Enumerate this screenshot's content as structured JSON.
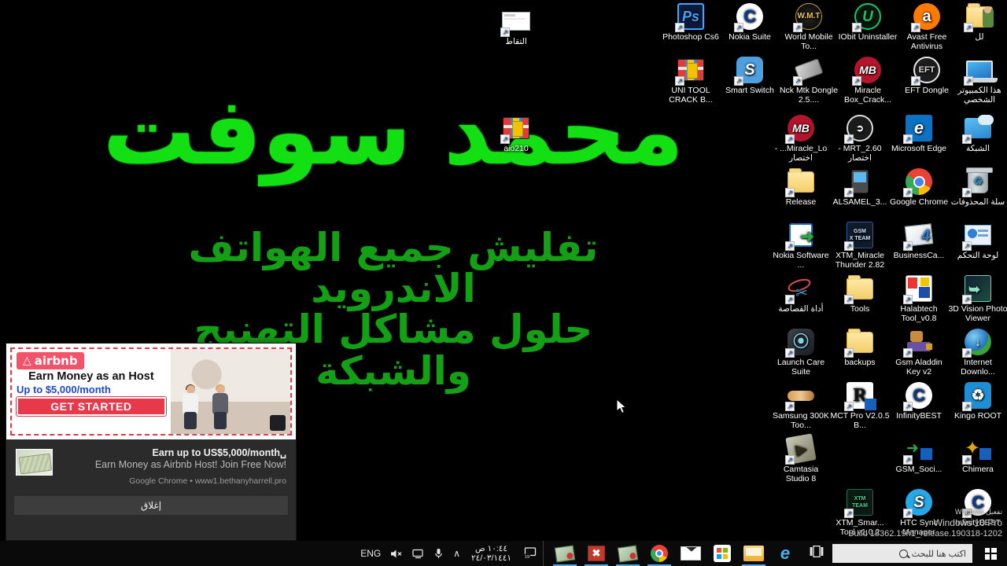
{
  "wallpaper": {
    "title": "محمد سوفت",
    "line1": "تفليش جميع الهواتف",
    "line2": "الاندرويد",
    "line3": "حلول مشاكل التهنيج",
    "line4": "والشبكة",
    "accent_color": "#12e012",
    "sub_color": "#14a014",
    "background_color": "#000000"
  },
  "desktop_icons": [
    {
      "label": "التقاط",
      "icon": "screenshot-capture-icon",
      "rtl": true
    },
    {
      "label": "aio210",
      "icon": "winrar-archive-icon",
      "rtl": false
    },
    {
      "label": "Photoshop Cs6",
      "icon": "photoshop-icon",
      "rtl": false
    },
    {
      "label": "Nokia Suite",
      "icon": "nokia-suite-icon",
      "rtl": false
    },
    {
      "label": "World Mobile To...",
      "icon": "world-mobile-tool-icon",
      "rtl": false
    },
    {
      "label": "IObit Uninstaller",
      "icon": "iobit-uninstaller-icon",
      "rtl": false
    },
    {
      "label": "Avast Free Antivirus",
      "icon": "avast-antivirus-icon",
      "rtl": false
    },
    {
      "label": "لل",
      "icon": "shared-folder-icon",
      "rtl": true
    },
    {
      "label": "UNI TOOL CRACK B...",
      "icon": "winrar-archive-icon",
      "rtl": false
    },
    {
      "label": "Smart Switch",
      "icon": "smart-switch-icon",
      "rtl": false
    },
    {
      "label": "Nck Mtk Dongle 2.5....",
      "icon": "nck-dongle-icon",
      "rtl": false
    },
    {
      "label": "Miracle Box_Crack...",
      "icon": "miracle-box-icon",
      "rtl": false
    },
    {
      "label": "EFT Dongle",
      "icon": "eft-dongle-icon",
      "rtl": false
    },
    {
      "label": "هذا الكمبيوتر الشخصي",
      "icon": "this-pc-icon",
      "rtl": true
    },
    {
      "label": "Miracle_Lo... - اختصار",
      "icon": "miracle-loader-icon",
      "rtl": true
    },
    {
      "label": "MRT_2.60 - اختصار",
      "icon": "mrt-dongle-icon",
      "rtl": true
    },
    {
      "label": "Microsoft Edge",
      "icon": "microsoft-edge-icon",
      "rtl": false
    },
    {
      "label": "الشبكة",
      "icon": "network-icon",
      "rtl": true
    },
    {
      "label": "Release",
      "icon": "folder-icon",
      "rtl": false
    },
    {
      "label": "ALSAMEL_3...",
      "icon": "alsamel-phone-icon",
      "rtl": false
    },
    {
      "label": "Google Chrome",
      "icon": "google-chrome-icon",
      "rtl": false
    },
    {
      "label": "سلة المحذوفات",
      "icon": "recycle-bin-icon",
      "rtl": true
    },
    {
      "label": "Nokia Software ...",
      "icon": "nokia-software-updater-icon",
      "rtl": false
    },
    {
      "label": "XTM_Miracle Thunder 2.82",
      "icon": "gsm-x-team-icon",
      "rtl": false
    },
    {
      "label": "BusinessCa...",
      "icon": "business-cards-icon",
      "rtl": false
    },
    {
      "label": "لوحة التحكم",
      "icon": "control-panel-icon",
      "rtl": true
    },
    {
      "label": "أداة القصاصة",
      "icon": "snipping-tool-icon",
      "rtl": true
    },
    {
      "label": "Tools",
      "icon": "folder-icon",
      "rtl": false
    },
    {
      "label": "Halabtech Tool_v0.8",
      "icon": "halabtech-tool-icon",
      "rtl": false
    },
    {
      "label": "3D Vision Photo Viewer",
      "icon": "3d-vision-photo-viewer-icon",
      "rtl": false
    },
    {
      "label": "Launch Care Suite",
      "icon": "launch-care-suite-icon",
      "rtl": false
    },
    {
      "label": "backups",
      "icon": "folder-icon",
      "rtl": false
    },
    {
      "label": "Gsm Aladdin Key v2",
      "icon": "gsm-aladdin-key-icon",
      "rtl": false
    },
    {
      "label": "Internet Downlo...",
      "icon": "internet-download-manager-icon",
      "rtl": false
    },
    {
      "label": "Samsung 300K Too...",
      "icon": "samsung-300k-tool-icon",
      "rtl": false
    },
    {
      "label": "MCT Pro V2.0.5 B...",
      "icon": "mct-pro-icon",
      "rtl": false
    },
    {
      "label": "InfinityBEST",
      "icon": "infinity-best-icon",
      "rtl": false
    },
    {
      "label": "Kingo ROOT",
      "icon": "kingo-root-icon",
      "rtl": false
    },
    {
      "label": "Camtasia Studio 8",
      "icon": "camtasia-studio-icon",
      "rtl": false
    },
    {
      "label": "GSM_Soci...",
      "icon": "gsm-social-icon",
      "rtl": false
    },
    {
      "label": "Chimera",
      "icon": "chimera-tool-icon",
      "rtl": false
    },
    {
      "label": "XTM_Smar... Tool v1.0.2",
      "icon": "xtm-smart-tool-icon",
      "rtl": false
    },
    {
      "label": "HTC Sync Manager",
      "icon": "htc-sync-manager-icon",
      "rtl": false
    },
    {
      "label": "InfinityBEST",
      "icon": "infinity-best-icon",
      "rtl": false
    }
  ],
  "notification": {
    "ad": {
      "brand": "airbnb",
      "headline": "Earn Money as an Host",
      "subline": "Up to $5,000/month",
      "cta": "GET STARTED"
    },
    "title": "Earn up to US$5,000/month␣",
    "description": "Earn Money as Airbnb Host! Join Free Now!",
    "source": "Google Chrome • www1.bethanyharrell.pro",
    "close_label": "إغلاق"
  },
  "watermark": {
    "activate": "تفعيل Windows",
    "line1": "Windows 10 Pro",
    "line2": "Build 18362.19h1_release.190318-1202"
  },
  "taskbar": {
    "start_label": "Start",
    "search_placeholder": "اكتب هنا للبحث",
    "apps": [
      {
        "name": "task-view-button",
        "icon": "task-view-icon",
        "active": false
      },
      {
        "name": "taskbar-edge",
        "icon": "microsoft-edge-icon",
        "active": false
      },
      {
        "name": "taskbar-file-explorer",
        "icon": "file-explorer-icon",
        "active": true
      },
      {
        "name": "taskbar-microsoft-store",
        "icon": "microsoft-store-icon",
        "active": false
      },
      {
        "name": "taskbar-mail",
        "icon": "mail-icon",
        "active": false
      },
      {
        "name": "taskbar-chrome",
        "icon": "google-chrome-icon",
        "active": true
      },
      {
        "name": "taskbar-photo-viewer",
        "icon": "photo-viewer-icon",
        "active": true
      },
      {
        "name": "taskbar-excel",
        "icon": "excel-icon",
        "active": true
      },
      {
        "name": "taskbar-photo-viewer-2",
        "icon": "photo-viewer-icon",
        "active": true
      }
    ],
    "tray": {
      "show_hidden": "∧",
      "microphone": "microphone-icon",
      "display": "display-icon",
      "volume": "volume-muted-icon",
      "language": "ENG",
      "clock_time": "١٠:٤٤ ص",
      "clock_date": "٢٤/٠٣/١٤٤١",
      "action_center": "notification-icon",
      "notification_count": "19"
    }
  }
}
